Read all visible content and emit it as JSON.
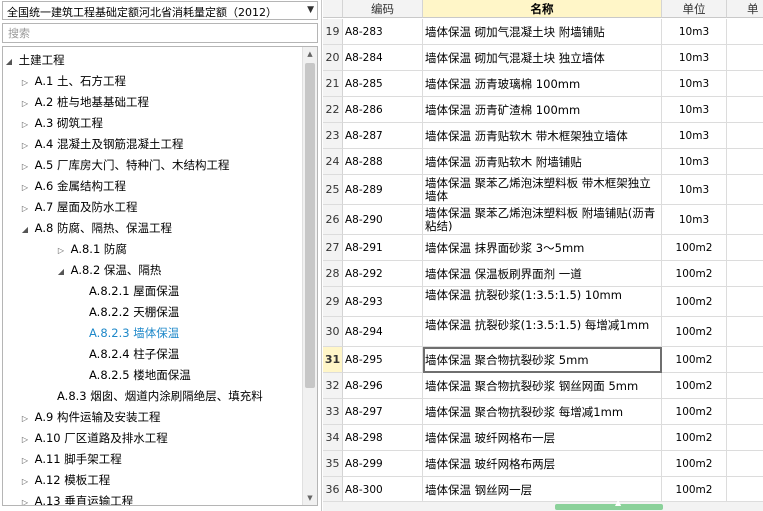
{
  "left_panel": {
    "quota_selector": "全国统一建筑工程基础定额河北省消耗量定额（2012）",
    "search_placeholder": "搜索",
    "tree": [
      {
        "label": "土建工程",
        "level": 0,
        "expanded": true,
        "has_children": true
      },
      {
        "label": "A.1 土、石方工程",
        "level": 1,
        "expanded": false,
        "has_children": true
      },
      {
        "label": "A.2 桩与地基基础工程",
        "level": 1,
        "expanded": false,
        "has_children": true
      },
      {
        "label": "A.3 砌筑工程",
        "level": 1,
        "expanded": false,
        "has_children": true
      },
      {
        "label": "A.4 混凝土及钢筋混凝土工程",
        "level": 1,
        "expanded": false,
        "has_children": true
      },
      {
        "label": "A.5 厂库房大门、特种门、木结构工程",
        "level": 1,
        "expanded": false,
        "has_children": true
      },
      {
        "label": "A.6 金属结构工程",
        "level": 1,
        "expanded": false,
        "has_children": true
      },
      {
        "label": "A.7 屋面及防水工程",
        "level": 1,
        "expanded": false,
        "has_children": true
      },
      {
        "label": "A.8 防腐、隔热、保温工程",
        "level": 1,
        "expanded": true,
        "has_children": true
      },
      {
        "label": "A.8.1 防腐",
        "level": 2,
        "expanded": false,
        "has_children": true
      },
      {
        "label": "A.8.2 保温、隔热",
        "level": 2,
        "expanded": true,
        "has_children": true
      },
      {
        "label": "A.8.2.1 屋面保温",
        "level": 3,
        "has_children": false
      },
      {
        "label": "A.8.2.2 天棚保温",
        "level": 3,
        "has_children": false
      },
      {
        "label": "A.8.2.3 墙体保温",
        "level": 3,
        "has_children": false,
        "selected": true
      },
      {
        "label": "A.8.2.4 柱子保温",
        "level": 3,
        "has_children": false
      },
      {
        "label": "A.8.2.5 楼地面保温",
        "level": 3,
        "has_children": false
      },
      {
        "label": "A.8.3 烟囱、烟道内涂刷隔绝层、填充料",
        "level": 2,
        "has_children": false
      },
      {
        "label": "A.9 构件运输及安装工程",
        "level": 1,
        "expanded": false,
        "has_children": true
      },
      {
        "label": "A.10 厂区道路及排水工程",
        "level": 1,
        "expanded": false,
        "has_children": true
      },
      {
        "label": "A.11 脚手架工程",
        "level": 1,
        "expanded": false,
        "has_children": true
      },
      {
        "label": "A.12 模板工程",
        "level": 1,
        "expanded": false,
        "has_children": true
      },
      {
        "label": "A.13 垂直运输工程",
        "level": 1,
        "expanded": false,
        "has_children": true
      }
    ]
  },
  "grid": {
    "headers": {
      "code": "编码",
      "name": "名称",
      "unit": "单位",
      "extra": "单"
    },
    "current_row": "31",
    "rows": [
      {
        "num": "19",
        "code": "A8-283",
        "name": "墙体保温 砌加气混凝土块 附墙铺贴",
        "unit": "10m3"
      },
      {
        "num": "20",
        "code": "A8-284",
        "name": "墙体保温 砌加气混凝土块 独立墙体",
        "unit": "10m3"
      },
      {
        "num": "21",
        "code": "A8-285",
        "name": "墙体保温 沥青玻璃棉 100mm",
        "unit": "10m3"
      },
      {
        "num": "22",
        "code": "A8-286",
        "name": "墙体保温 沥青矿渣棉 100mm",
        "unit": "10m3"
      },
      {
        "num": "23",
        "code": "A8-287",
        "name": "墙体保温 沥青贴软木 带木框架独立墙体",
        "unit": "10m3"
      },
      {
        "num": "24",
        "code": "A8-288",
        "name": "墙体保温 沥青贴软木 附墙铺贴",
        "unit": "10m3"
      },
      {
        "num": "25",
        "code": "A8-289",
        "name": "墙体保温 聚苯乙烯泡沫塑料板 带木框架独立墙体",
        "unit": "10m3"
      },
      {
        "num": "26",
        "code": "A8-290",
        "name": "墙体保温 聚苯乙烯泡沫塑料板 附墙铺贴(沥青粘结)",
        "unit": "10m3"
      },
      {
        "num": "27",
        "code": "A8-291",
        "name": "墙体保温 抹界面砂浆 3～5mm",
        "unit": "100m2"
      },
      {
        "num": "28",
        "code": "A8-292",
        "name": "墙体保温 保温板刷界面剂 一道",
        "unit": "100m2"
      },
      {
        "num": "29",
        "code": "A8-293",
        "name": "墙体保温 抗裂砂浆(1:3.5:1.5) 10mm",
        "unit": "100m2"
      },
      {
        "num": "30",
        "code": "A8-294",
        "name": "墙体保温 抗裂砂浆(1:3.5:1.5) 每增减1mm",
        "unit": "100m2"
      },
      {
        "num": "31",
        "code": "A8-295",
        "name": "墙体保温 聚合物抗裂砂浆 5mm",
        "unit": "100m2"
      },
      {
        "num": "32",
        "code": "A8-296",
        "name": "墙体保温 聚合物抗裂砂浆 钢丝网面 5mm",
        "unit": "100m2"
      },
      {
        "num": "33",
        "code": "A8-297",
        "name": "墙体保温 聚合物抗裂砂浆 每增减1mm",
        "unit": "100m2"
      },
      {
        "num": "34",
        "code": "A8-298",
        "name": "墙体保温 玻纤网格布一层",
        "unit": "100m2"
      },
      {
        "num": "35",
        "code": "A8-299",
        "name": "墙体保温 玻纤网格布两层",
        "unit": "100m2"
      },
      {
        "num": "36",
        "code": "A8-300",
        "name": "墙体保温 钢丝网一层",
        "unit": "100m2"
      }
    ]
  },
  "colors": {
    "selected_text": "#1e88c9",
    "active_header": "#fff6c8",
    "scroll_thumb": "#8bd19a"
  }
}
